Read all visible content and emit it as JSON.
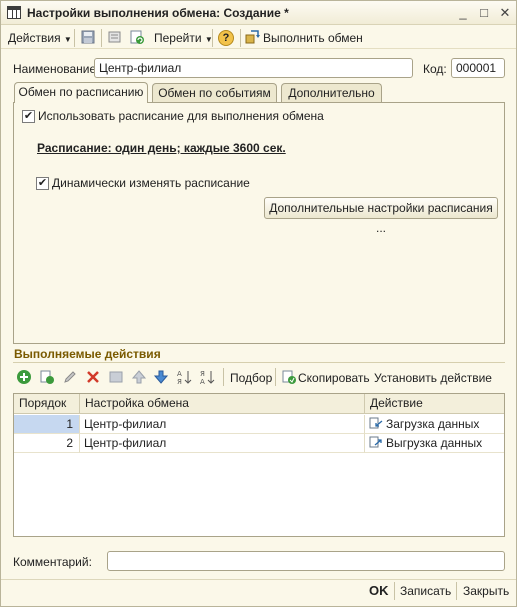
{
  "window": {
    "title": "Настройки выполнения обмена: Создание *",
    "controls": [
      "_",
      "□",
      "✕"
    ]
  },
  "toolbar": {
    "actions_label": "Действия",
    "goto_label": "Перейти",
    "help_label": "?",
    "execute_label": "Выполнить обмен"
  },
  "form": {
    "name_label": "Наименование:",
    "name_value": "Центр-филиал",
    "code_label": "Код:",
    "code_value": "000001"
  },
  "tabs": [
    {
      "label": "Обмен по расписанию",
      "active": true
    },
    {
      "label": "Обмен по событиям",
      "active": false
    },
    {
      "label": "Дополнительно",
      "active": false
    }
  ],
  "schedule_tab": {
    "use_schedule_label": "Использовать расписание для выполнения обмена",
    "use_schedule_checked": true,
    "schedule_text": "Расписание: один день; каждые 3600 сек.",
    "dynamic_label": "Динамически изменять расписание",
    "dynamic_checked": true,
    "extra_settings_label": "Дополнительные настройки расписания ..."
  },
  "actions_section": {
    "title": "Выполняемые действия",
    "toolbar": {
      "pick_label": "Подбор",
      "copy_label": "Скопировать",
      "set_action_label": "Установить действие"
    },
    "columns": [
      "Порядок",
      "Настройка обмена",
      "Действие"
    ],
    "rows": [
      {
        "order": "1",
        "setting": "Центр-филиал",
        "action": "Загрузка данных"
      },
      {
        "order": "2",
        "setting": "Центр-филиал",
        "action": "Выгрузка данных"
      }
    ]
  },
  "comment": {
    "label": "Комментарий:",
    "value": ""
  },
  "footer": {
    "ok_label": "OK",
    "save_label": "Записать",
    "close_label": "Закрыть"
  },
  "colors": {
    "window_bg": "#fbf8e9",
    "section_title": "#7a5a00",
    "selected_cell": "#c6d8f0"
  }
}
